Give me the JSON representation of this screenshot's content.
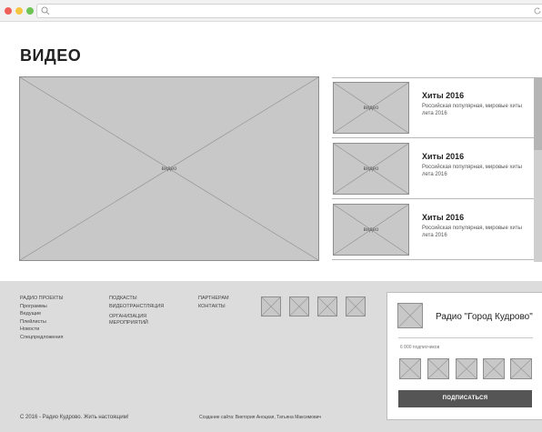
{
  "colors": {
    "placeholder_fill": "#c8c8c8",
    "placeholder_stroke": "#8e8e8e",
    "footer_bg": "#dcdcdc",
    "button_bg": "#555555"
  },
  "browser": {
    "icons": [
      "search-icon",
      "reload-icon"
    ]
  },
  "page": {
    "title": "ВИДЕО"
  },
  "main_video": {
    "label": "видео"
  },
  "video_list": [
    {
      "thumb_label": "видео",
      "title": "Хиты 2016",
      "description": "Российская популярная, мировые хиты лета 2016"
    },
    {
      "thumb_label": "видео",
      "title": "Хиты 2016",
      "description": "Российская популярная, мировые хиты лета 2016"
    },
    {
      "thumb_label": "видео",
      "title": "Хиты 2016",
      "description": "Российская популярная, мировые хиты лета 2016"
    }
  ],
  "footer": {
    "col1": [
      "РАДИО ПРОЕКТЫ",
      "Программы",
      "Ведущие",
      "Плейлисты",
      "Новости",
      "Спецпредложения"
    ],
    "col2": [
      "ПОДКАСТЫ",
      "ВИДЕОТРАНСТЛЯЦИЯ",
      "ОРГАНИЗАЦИЯ",
      "МЕРОПРИЯТИЙ"
    ],
    "col3": [
      "ПАРТНЕРАМ",
      "КОНТАКТЫ"
    ],
    "copyright": "С 2016 - Радио Кудрово. Жить настоящим!",
    "credit": "Создание сайта: Виктория Аноцкая, Татьяна Максимович"
  },
  "widget": {
    "title": "Радио \"Город Кудрово\"",
    "subscribers": "6 000 подписчиков",
    "subscribe_button": "ПОДПИСАТЬСЯ"
  }
}
